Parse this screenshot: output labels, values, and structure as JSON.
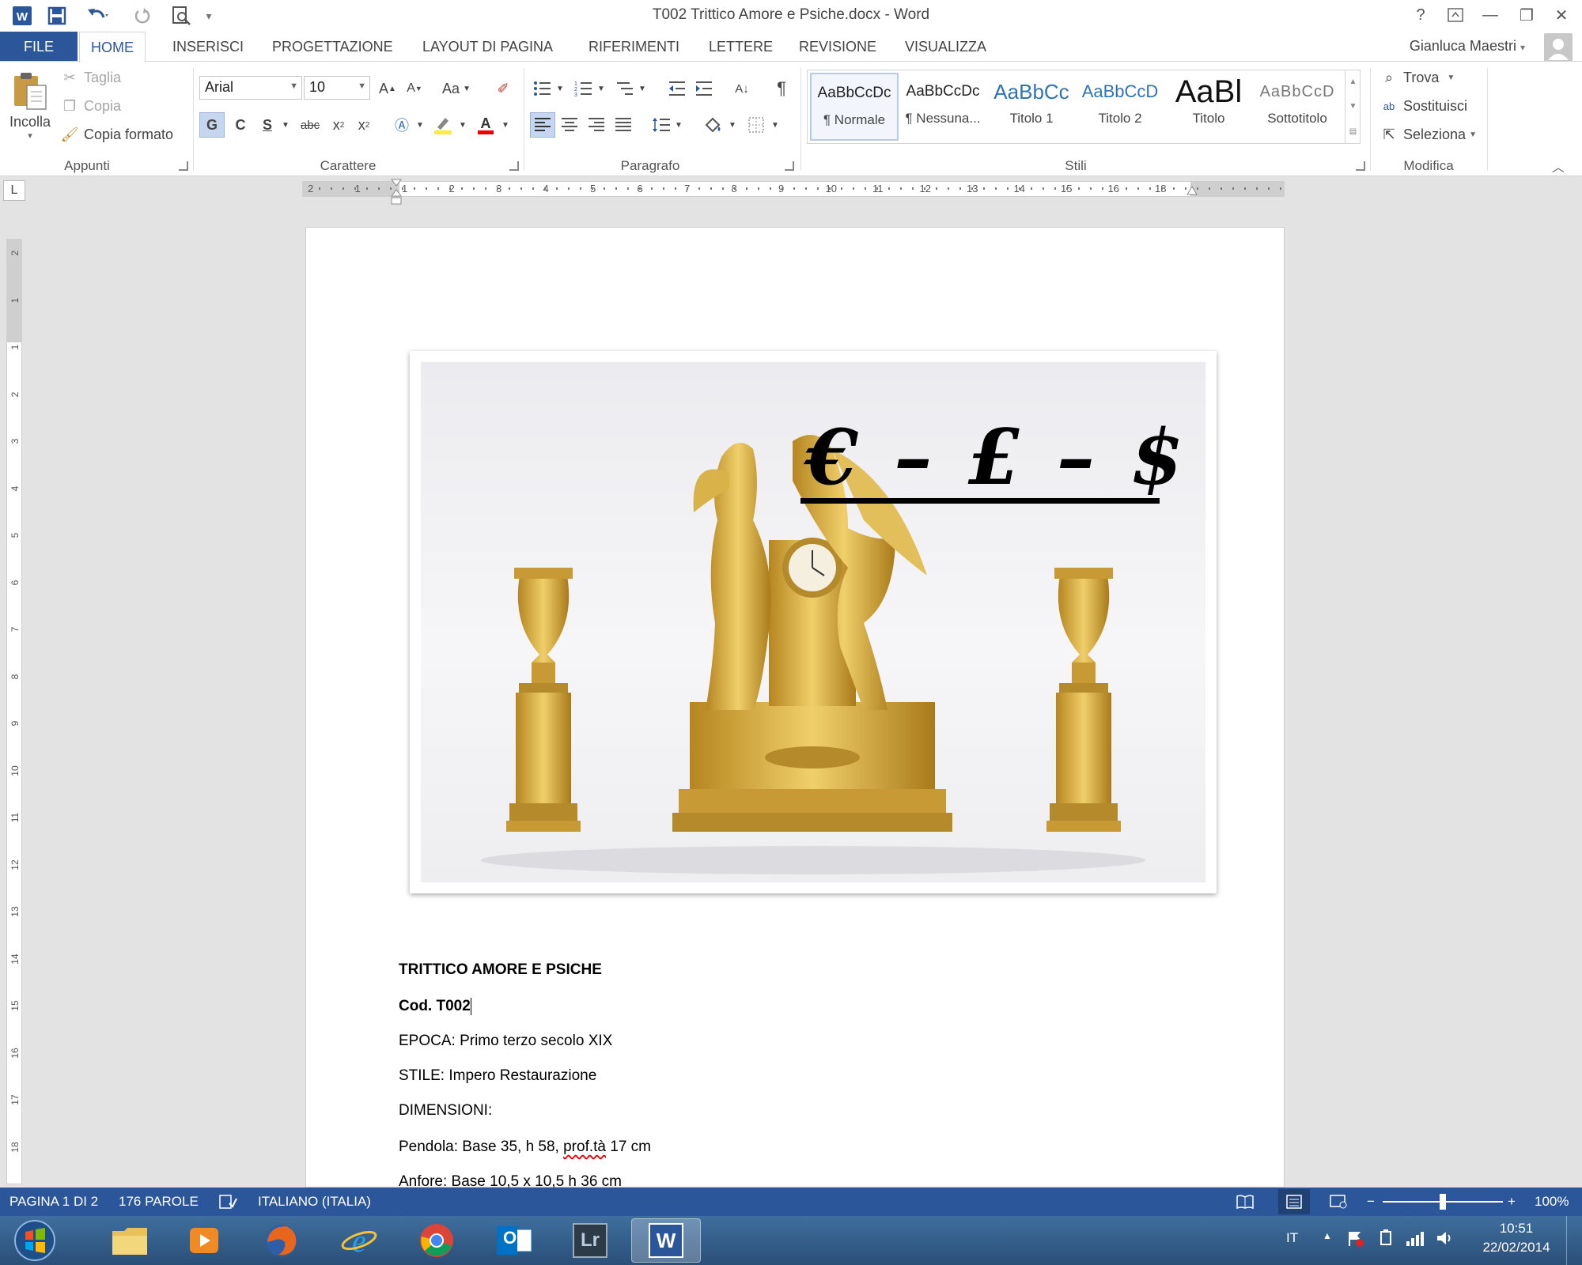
{
  "window": {
    "title": "T002 Trittico Amore e Psiche.docx - Word",
    "help": "?",
    "minimize": "—",
    "restore": "❐",
    "close": "✕"
  },
  "qat": {
    "word_icon": "word-app-icon",
    "save_icon": "save-icon",
    "undo_icon": "undo-icon",
    "redo_icon": "redo-icon",
    "preview_icon": "print-preview-icon"
  },
  "tabs": [
    {
      "label": "FILE"
    },
    {
      "label": "HOME"
    },
    {
      "label": "INSERISCI"
    },
    {
      "label": "PROGETTAZIONE"
    },
    {
      "label": "LAYOUT DI PAGINA"
    },
    {
      "label": "RIFERIMENTI"
    },
    {
      "label": "LETTERE"
    },
    {
      "label": "REVISIONE"
    },
    {
      "label": "VISUALIZZA"
    }
  ],
  "user": {
    "name": "Gianluca Maestri"
  },
  "clipboard": {
    "paste": "Incolla",
    "cut": "Taglia",
    "copy": "Copia",
    "format_painter": "Copia formato",
    "group": "Appunti"
  },
  "font": {
    "name": "Arial",
    "size": "10",
    "grow": "A",
    "shrink": "A",
    "case": "Aa",
    "bold": "G",
    "italic": "C",
    "underline": "S",
    "strike": "abc",
    "group": "Carattere"
  },
  "paragraph": {
    "group": "Paragrafo",
    "pilcrow": "¶"
  },
  "styles": {
    "group": "Stili",
    "items": [
      {
        "preview": "AaBbCcDc",
        "name": "¶ Normale"
      },
      {
        "preview": "AaBbCcDc",
        "name": "¶ Nessuna..."
      },
      {
        "preview": "AaBbCc",
        "name": "Titolo 1"
      },
      {
        "preview": "AaBbCcD",
        "name": "Titolo 2"
      },
      {
        "preview": "AaBl",
        "name": "Titolo"
      },
      {
        "preview": "AaBbCcD",
        "name": "Sottotitolo"
      }
    ]
  },
  "editing": {
    "group": "Modifica",
    "find": "Trova",
    "replace": "Sostituisci",
    "select": "Seleziona"
  },
  "ruler": {
    "h_numbers": [
      "2",
      "1",
      "1",
      "2",
      "3",
      "4",
      "5",
      "6",
      "7",
      "8",
      "9",
      "10",
      "11",
      "12",
      "13",
      "14",
      "15",
      "16",
      "18"
    ],
    "v_numbers": [
      "2",
      "1",
      "1",
      "2",
      "3",
      "4",
      "5",
      "6",
      "7",
      "8",
      "9",
      "10",
      "11",
      "12",
      "13",
      "14",
      "15",
      "16",
      "17",
      "18"
    ],
    "tab_stop": "L"
  },
  "document": {
    "logo_text": "€ – £ – $",
    "lines": [
      "TRITTICO AMORE E PSICHE",
      "Cod. T002",
      "EPOCA: Primo terzo secolo XIX",
      "STILE: Impero Restaurazione",
      "DIMENSIONI:",
      "Pendola: Base 35, h 58, ",
      "prof.tà",
      " 17 cm",
      "Anfore: Base 10,5 x 10,5 h 36 cm"
    ]
  },
  "status": {
    "page": "PAGINA 1 DI 2",
    "words": "176 PAROLE",
    "language": "ITALIANO (ITALIA)",
    "zoom": "100%",
    "zoom_minus": "−",
    "zoom_plus": "+"
  },
  "taskbar": {
    "lang": "IT",
    "time": "10:51",
    "date": "22/02/2014",
    "lightroom": "Lr",
    "outlook": "O",
    "word": "W"
  },
  "colors": {
    "accent": "#2b579a",
    "gold": "#d4a83a"
  }
}
